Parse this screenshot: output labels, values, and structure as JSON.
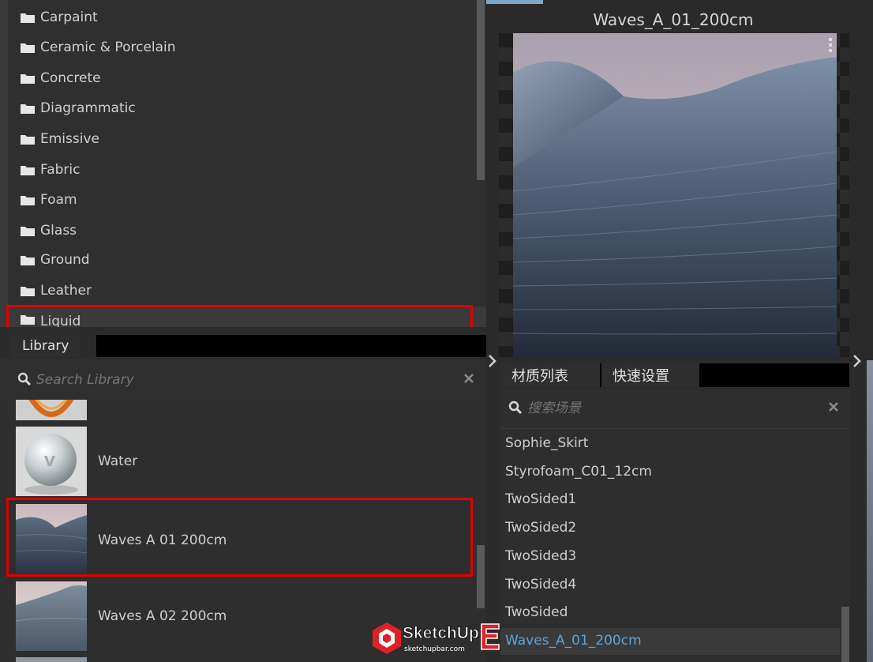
{
  "library": {
    "folders": [
      {
        "label": "Carpaint"
      },
      {
        "label": "Ceramic & Porcelain"
      },
      {
        "label": "Concrete"
      },
      {
        "label": "Diagrammatic"
      },
      {
        "label": "Emissive"
      },
      {
        "label": "Fabric"
      },
      {
        "label": "Foam"
      },
      {
        "label": "Glass"
      },
      {
        "label": "Ground"
      },
      {
        "label": "Leather"
      },
      {
        "label": "Liquid"
      }
    ],
    "tab_label": "Library",
    "search_placeholder": "Search Library",
    "items": [
      {
        "label": ""
      },
      {
        "label": "Water"
      },
      {
        "label": "Waves A 01 200cm"
      },
      {
        "label": "Waves A 02 200cm"
      }
    ]
  },
  "preview": {
    "title": "Waves_A_01_200cm"
  },
  "materials": {
    "tabs": [
      {
        "label": "材质列表"
      },
      {
        "label": "快速设置"
      }
    ],
    "search_placeholder": "搜索场景",
    "items": [
      {
        "label": "Sophie_Skirt"
      },
      {
        "label": "Styrofoam_C01_12cm"
      },
      {
        "label": "TwoSided1"
      },
      {
        "label": "TwoSided2"
      },
      {
        "label": "TwoSided3"
      },
      {
        "label": "TwoSided4"
      },
      {
        "label": "TwoSided"
      },
      {
        "label": "Waves_A_01_200cm"
      }
    ],
    "selected_color": "#5ba3d9"
  },
  "watermark": {
    "brand": "SketchUp",
    "url": "sketchupbar.com"
  },
  "colors": {
    "highlight_box": "#e00000",
    "panel_bg": "#2e2e2e"
  }
}
